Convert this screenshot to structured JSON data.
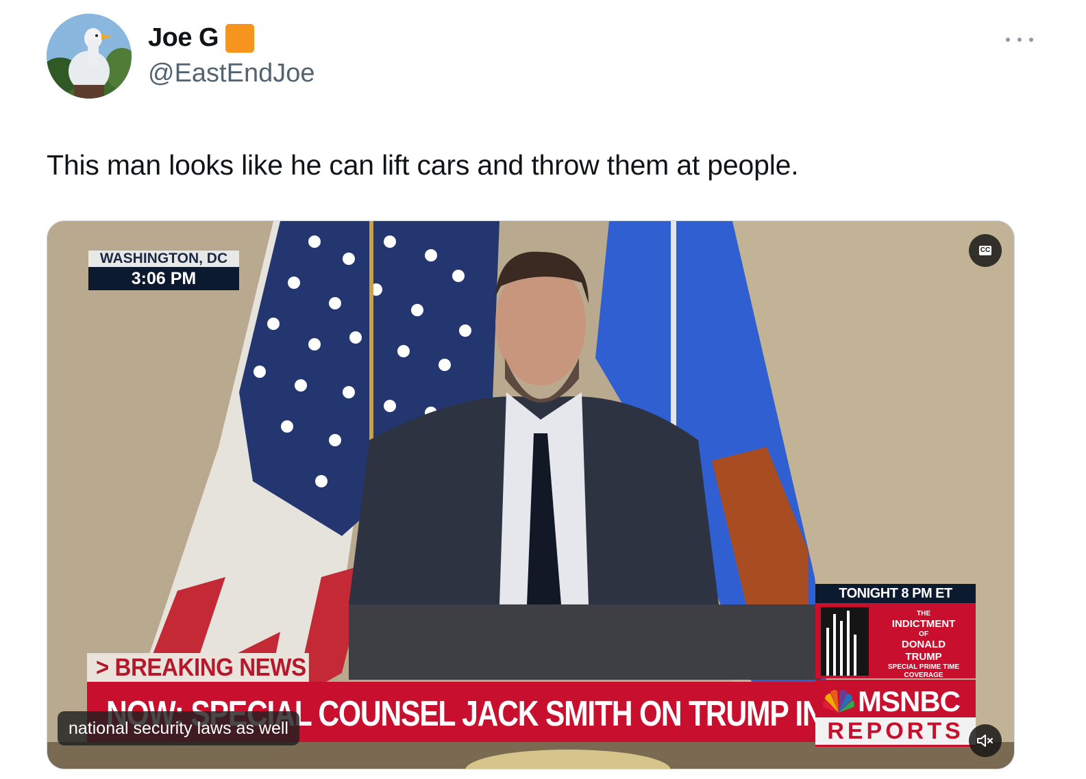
{
  "author": {
    "display_name": "Joe G",
    "handle": "@EastEndJoe",
    "avatar_icon": "duck-statue-avatar",
    "badge_icon": "orange-square-emoji",
    "badge_color": "#f7941d"
  },
  "menu": {
    "icon": "more-dots-icon"
  },
  "tweet": {
    "text": "This man looks like he can lift cars and throw them at people."
  },
  "video": {
    "location": "WASHINGTON, DC",
    "time": "3:06 PM",
    "breaking_label": "> BREAKING NEWS",
    "headline": "NOW: SPECIAL COUNSEL JACK SMITH ON TRUMP INDICTMENT",
    "promo_top": "TONIGHT 8 PM ET",
    "promo_lines": [
      "THE",
      "INDICTMENT",
      "OF",
      "DONALD",
      "TRUMP",
      "SPECIAL PRIME TIME",
      "COVERAGE"
    ],
    "network": "MSNBC",
    "network_sub": "REPORTS",
    "caption": "national security laws as well",
    "cc_label": "CC",
    "cc_icon": "closed-captions-icon",
    "mute_icon": "muted-speaker-icon"
  },
  "colors": {
    "msnbc_red": "#c8102e",
    "navy": "#0c1a30",
    "handle_gray": "#536471"
  }
}
